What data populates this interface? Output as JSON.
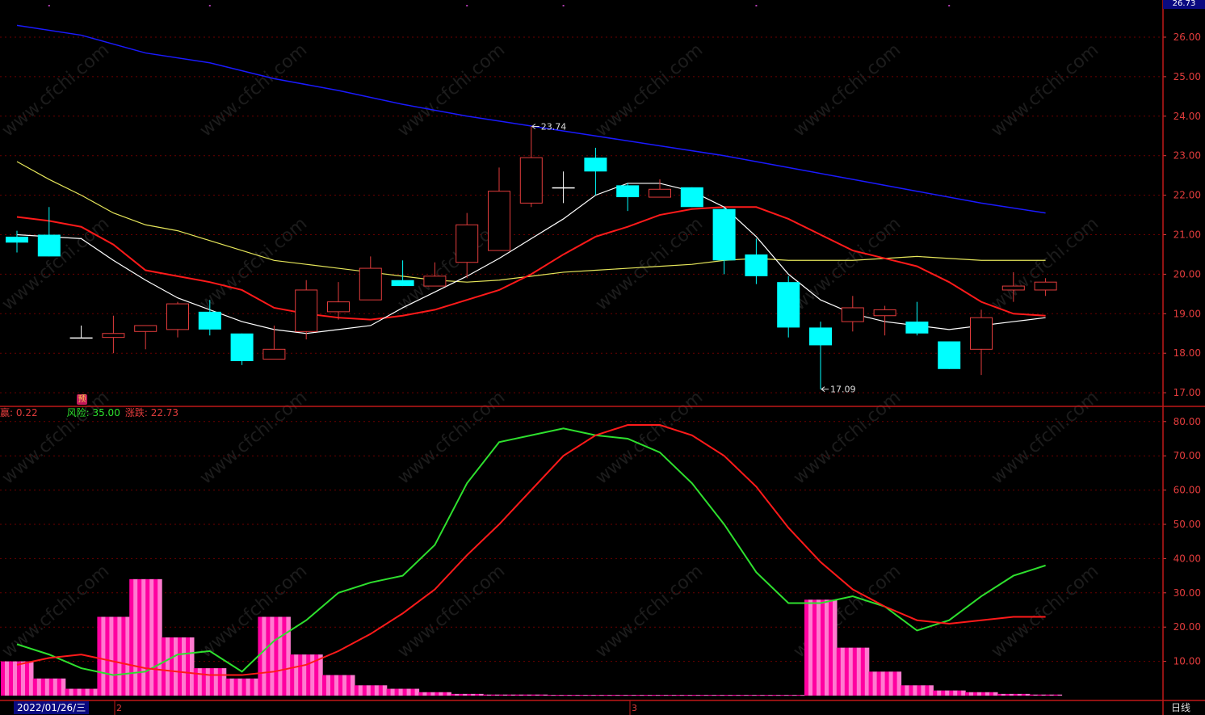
{
  "header": {
    "top_price": "26.73"
  },
  "footer": {
    "date_label": "2022/01/26/三",
    "period_label": "日线",
    "month_marks": [
      "2",
      "3"
    ]
  },
  "badge": {
    "label": "预"
  },
  "legend": {
    "l1_label": "赢:",
    "l1_value": "0.22",
    "l2_label": "风险:",
    "l2_value": "35.00",
    "l3_label": "涨跌:",
    "l3_value": "22.73"
  },
  "watermark": {
    "text": "www.cfchi.com"
  },
  "colors": {
    "up": "#e23c3c",
    "down": "#00ffff",
    "doji": "#ffffff",
    "ma_white": "#ffffff",
    "ma_red": "#ff1a1a",
    "ma_yellow": "#e6e65a",
    "ma_blue": "#1a1aff",
    "ind_green": "#2ee02e",
    "ind_red": "#ff1a1a",
    "bar_pink": "#ff1aa8",
    "grid": "#6b0000"
  },
  "chart_data": [
    {
      "type": "candlestick",
      "title": "",
      "ylim": [
        16.8,
        26.73
      ],
      "yticks": [
        "26.00",
        "25.00",
        "24.00",
        "23.00",
        "22.00",
        "21.00",
        "20.00",
        "19.00",
        "18.00",
        "17.00"
      ],
      "ytick_values": [
        26,
        25,
        24,
        23,
        22,
        21,
        20,
        19,
        18,
        17
      ],
      "annotations": [
        {
          "text": "23.74",
          "candle": 16,
          "value": 23.74
        },
        {
          "text": "17.09",
          "candle": 25,
          "value": 17.09
        }
      ],
      "candles": [
        {
          "open": 20.95,
          "close": 20.8,
          "high": 21.1,
          "low": 20.55
        },
        {
          "open": 21.0,
          "close": 20.45,
          "high": 21.7,
          "low": 20.45
        },
        {
          "open": 18.4,
          "close": 18.4,
          "high": 18.7,
          "low": 18.4
        },
        {
          "open": 18.4,
          "close": 18.5,
          "high": 18.95,
          "low": 18.0
        },
        {
          "open": 18.55,
          "close": 18.7,
          "high": 18.7,
          "low": 18.1
        },
        {
          "open": 18.6,
          "close": 19.25,
          "high": 19.3,
          "low": 18.4
        },
        {
          "open": 19.05,
          "close": 18.6,
          "high": 19.35,
          "low": 18.45
        },
        {
          "open": 18.5,
          "close": 17.8,
          "high": 18.5,
          "low": 17.7
        },
        {
          "open": 17.85,
          "close": 18.1,
          "high": 18.7,
          "low": 17.85
        },
        {
          "open": 18.55,
          "close": 19.6,
          "high": 19.85,
          "low": 18.35
        },
        {
          "open": 19.05,
          "close": 19.3,
          "high": 19.8,
          "low": 18.85
        },
        {
          "open": 19.35,
          "close": 20.15,
          "high": 20.45,
          "low": 19.35
        },
        {
          "open": 19.85,
          "close": 19.7,
          "high": 20.35,
          "low": 19.7
        },
        {
          "open": 19.7,
          "close": 19.95,
          "high": 20.3,
          "low": 19.7
        },
        {
          "open": 20.3,
          "close": 21.25,
          "high": 21.55,
          "low": 19.9
        },
        {
          "open": 20.6,
          "close": 22.1,
          "high": 22.7,
          "low": 20.6
        },
        {
          "open": 21.8,
          "close": 22.95,
          "high": 23.74,
          "low": 21.7
        },
        {
          "open": 22.2,
          "close": 22.2,
          "high": 22.6,
          "low": 21.8
        },
        {
          "open": 22.95,
          "close": 22.6,
          "high": 23.2,
          "low": 22.0
        },
        {
          "open": 22.25,
          "close": 21.95,
          "high": 22.3,
          "low": 21.6
        },
        {
          "open": 21.95,
          "close": 22.15,
          "high": 22.4,
          "low": 21.95
        },
        {
          "open": 22.2,
          "close": 21.7,
          "high": 22.2,
          "low": 21.7
        },
        {
          "open": 21.65,
          "close": 20.35,
          "high": 21.7,
          "low": 20.0
        },
        {
          "open": 20.5,
          "close": 19.95,
          "high": 20.9,
          "low": 19.75
        },
        {
          "open": 19.8,
          "close": 18.65,
          "high": 19.95,
          "low": 18.4
        },
        {
          "open": 18.65,
          "close": 18.2,
          "high": 18.8,
          "low": 17.09
        },
        {
          "open": 18.8,
          "close": 19.15,
          "high": 19.45,
          "low": 18.55
        },
        {
          "open": 18.95,
          "close": 19.1,
          "high": 19.2,
          "low": 18.45
        },
        {
          "open": 18.8,
          "close": 18.5,
          "high": 19.3,
          "low": 18.45
        },
        {
          "open": 18.3,
          "close": 17.6,
          "high": 18.3,
          "low": 17.6
        },
        {
          "open": 18.1,
          "close": 18.9,
          "high": 19.1,
          "low": 17.45
        },
        {
          "open": 19.6,
          "close": 19.7,
          "high": 20.05,
          "low": 19.3
        },
        {
          "open": 19.6,
          "close": 19.8,
          "high": 19.9,
          "low": 19.45
        }
      ],
      "series": [
        {
          "color": "#ffffff",
          "x": [
            0,
            2,
            3,
            4,
            5,
            6,
            7,
            8,
            9,
            10,
            11,
            12,
            13,
            14,
            15,
            16,
            17,
            18,
            19,
            20,
            21,
            22,
            23,
            24,
            25,
            26,
            27,
            28,
            29,
            30,
            31,
            32
          ],
          "values": [
            21.0,
            20.9,
            20.35,
            19.85,
            19.4,
            19.1,
            18.8,
            18.6,
            18.5,
            18.6,
            18.7,
            19.15,
            19.55,
            19.95,
            20.4,
            20.9,
            21.4,
            22.0,
            22.3,
            22.3,
            22.1,
            21.7,
            20.95,
            20.0,
            19.35,
            19.0,
            18.8,
            18.7,
            18.6,
            18.7,
            18.8,
            18.9
          ]
        },
        {
          "color": "#ff1a1a",
          "x": [
            0,
            1,
            2,
            3,
            4,
            5,
            6,
            7,
            8,
            9,
            10,
            11,
            12,
            13,
            14,
            15,
            16,
            17,
            18,
            19,
            20,
            21,
            22,
            23,
            24,
            25,
            26,
            27,
            28,
            29,
            30,
            31,
            32
          ],
          "values": [
            21.45,
            21.35,
            21.2,
            20.75,
            20.1,
            19.95,
            19.8,
            19.6,
            19.15,
            19.0,
            18.9,
            18.85,
            18.95,
            19.1,
            19.35,
            19.6,
            20.0,
            20.5,
            20.95,
            21.2,
            21.5,
            21.65,
            21.7,
            21.7,
            21.4,
            21.0,
            20.6,
            20.4,
            20.2,
            19.8,
            19.3,
            19.0,
            18.95
          ]
        },
        {
          "color": "#e6e65a",
          "x": [
            0,
            1,
            2,
            3,
            4,
            5,
            6,
            7,
            8,
            9,
            10,
            11,
            12,
            13,
            14,
            15,
            16,
            17,
            18,
            19,
            20,
            21,
            22,
            23,
            24,
            25,
            26,
            27,
            28,
            29,
            30,
            31,
            32
          ],
          "values": [
            22.85,
            22.4,
            22.0,
            21.55,
            21.25,
            21.1,
            20.85,
            20.6,
            20.35,
            20.25,
            20.15,
            20.05,
            19.95,
            19.85,
            19.8,
            19.85,
            19.95,
            20.05,
            20.1,
            20.15,
            20.2,
            20.25,
            20.35,
            20.4,
            20.35,
            20.35,
            20.35,
            20.4,
            20.45,
            20.4,
            20.35,
            20.35,
            20.35
          ]
        },
        {
          "color": "#1a1aff",
          "x": [
            0,
            2,
            4,
            6,
            8,
            10,
            12,
            14,
            16,
            18,
            20,
            22,
            24,
            26,
            28,
            30,
            32
          ],
          "values": [
            26.3,
            26.05,
            25.6,
            25.35,
            24.95,
            24.65,
            24.3,
            24.0,
            23.75,
            23.5,
            23.25,
            23.0,
            22.7,
            22.4,
            22.1,
            21.8,
            21.55
          ]
        }
      ]
    },
    {
      "type": "line+bar",
      "title": "",
      "ylim": [
        0,
        82
      ],
      "yticks": [
        "80.00",
        "70.00",
        "60.00",
        "50.00",
        "40.00",
        "30.00",
        "20.00",
        "10.00"
      ],
      "ytick_values": [
        80,
        70,
        60,
        50,
        40,
        30,
        20,
        10
      ],
      "bars": [
        10,
        5,
        2,
        23,
        34,
        17,
        8,
        5,
        23,
        12,
        6,
        3,
        2,
        1,
        0.5,
        0.3,
        0.3,
        0.2,
        0.2,
        0.2,
        0.2,
        0.2,
        0.2,
        0.2,
        0.2,
        28,
        14,
        7,
        3,
        1.5,
        1,
        0.5,
        0.3
      ],
      "series": [
        {
          "color": "#2ee02e",
          "x": [
            0,
            1,
            2,
            3,
            4,
            5,
            6,
            7,
            8,
            9,
            10,
            11,
            12,
            13,
            14,
            15,
            16,
            17,
            18,
            19,
            20,
            21,
            22,
            23,
            24,
            25,
            26,
            27,
            28,
            29,
            30,
            31,
            32
          ],
          "values": [
            15,
            12,
            8,
            6,
            7,
            12,
            13,
            7,
            16,
            22,
            30,
            33,
            35,
            44,
            62,
            74,
            76,
            78,
            76,
            75,
            71,
            62,
            50,
            36,
            27,
            27,
            29,
            26,
            19,
            22,
            29,
            35,
            38
          ]
        },
        {
          "color": "#ff1a1a",
          "x": [
            0,
            1,
            2,
            3,
            4,
            5,
            6,
            7,
            8,
            9,
            10,
            11,
            12,
            13,
            14,
            15,
            16,
            17,
            18,
            19,
            20,
            21,
            22,
            23,
            24,
            25,
            26,
            27,
            28,
            29,
            30,
            31,
            32
          ],
          "values": [
            9,
            11,
            12,
            10,
            8,
            7,
            6,
            6,
            7,
            9,
            13,
            18,
            24,
            31,
            41,
            50,
            60,
            70,
            76,
            79,
            79,
            76,
            70,
            61,
            49,
            39,
            31,
            26,
            22,
            21,
            22,
            23,
            23
          ]
        }
      ]
    }
  ]
}
